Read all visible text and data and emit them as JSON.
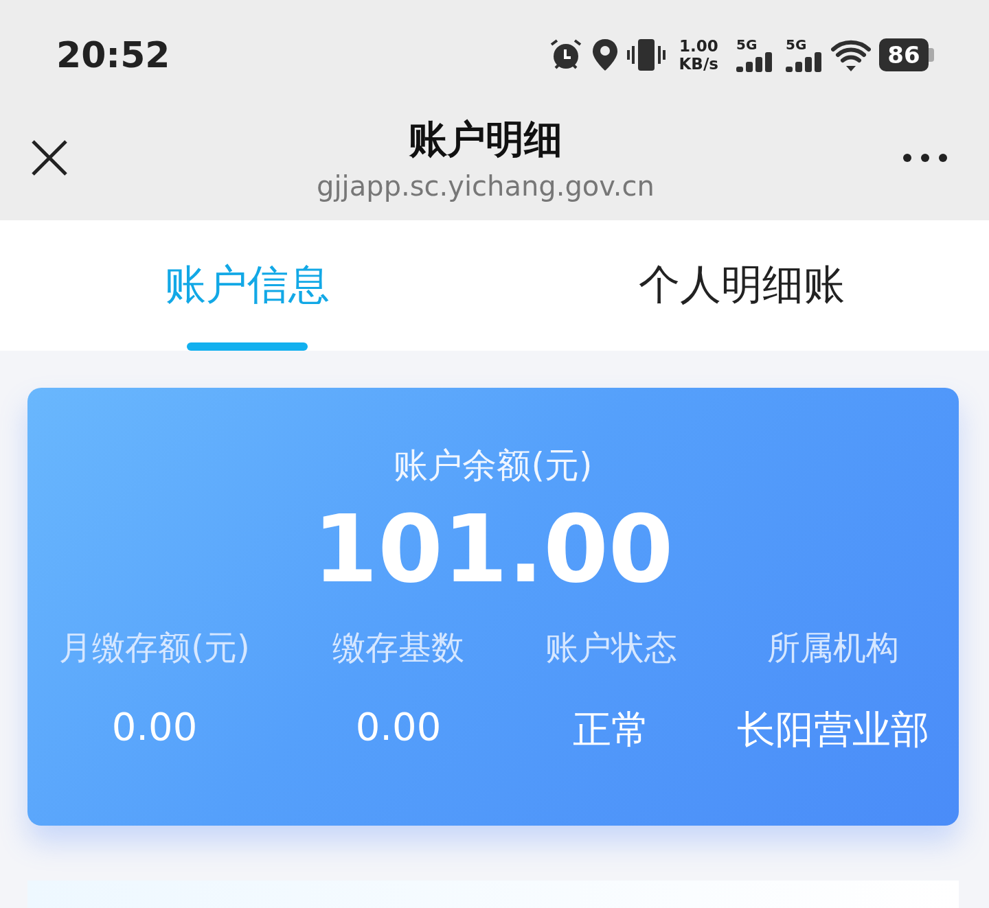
{
  "status_bar": {
    "time": "20:52",
    "speed_value": "1.00",
    "speed_unit": "KB/s",
    "sims": [
      "5G",
      "5G"
    ],
    "battery": "86"
  },
  "header": {
    "title": "账户明细",
    "url": "gjjapp.sc.yichang.gov.cn"
  },
  "tabs": [
    {
      "label": "账户信息",
      "selected": true
    },
    {
      "label": "个人明细账",
      "selected": false
    }
  ],
  "account_card": {
    "label": "账户余额(元)",
    "balance": "101.00",
    "stats": [
      {
        "label": "月缴存额(元)",
        "value": "0.00"
      },
      {
        "label": "缴存基数",
        "value": "0.00"
      },
      {
        "label": "账户状态",
        "value": "正常"
      },
      {
        "label": "所属机构",
        "value": "长阳营业部"
      }
    ]
  }
}
